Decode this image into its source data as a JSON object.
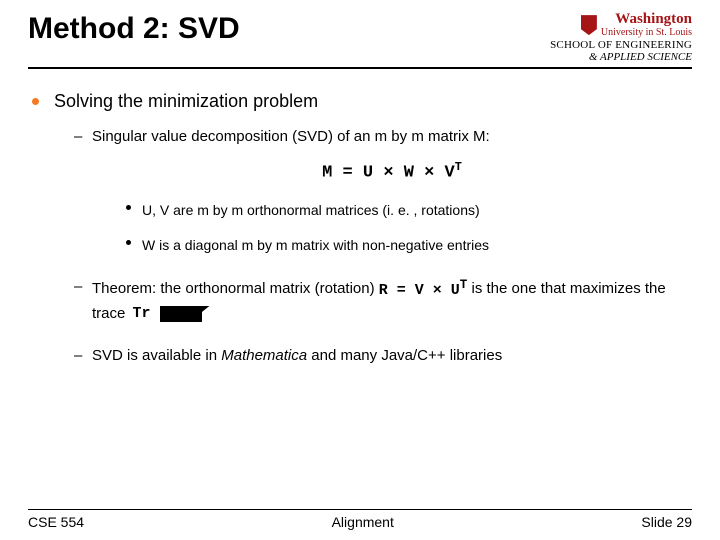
{
  "logo": {
    "university": "Washington",
    "city": "University in St. Louis",
    "school_line1": "SCHOOL OF ENGINEERING",
    "school_line2": "& APPLIED SCIENCE"
  },
  "title": "Method 2: SVD",
  "bullet1": "Solving the minimization problem",
  "sub1": "Singular value decomposition (SVD) of an m by m matrix M:",
  "eq_main": "M = U × W × V",
  "eq_main_sup": "T",
  "sub1a": "U, V are m by m orthonormal matrices (i. e. , rotations)",
  "sub1b": "W is a diagonal m by m matrix with non-negative entries",
  "sub2_pre": "Theorem: the orthonormal matrix (rotation) ",
  "eq_r": "R = V × U",
  "eq_r_sup": "T",
  "sub2_mid": " is the one that maximizes the trace ",
  "tr": "Tr",
  "sub3_a": "SVD is available in ",
  "sub3_b": "Mathematica",
  "sub3_c": " and many Java/C++ libraries",
  "footer": {
    "left": "CSE 554",
    "center": "Alignment",
    "right": "Slide 29"
  }
}
